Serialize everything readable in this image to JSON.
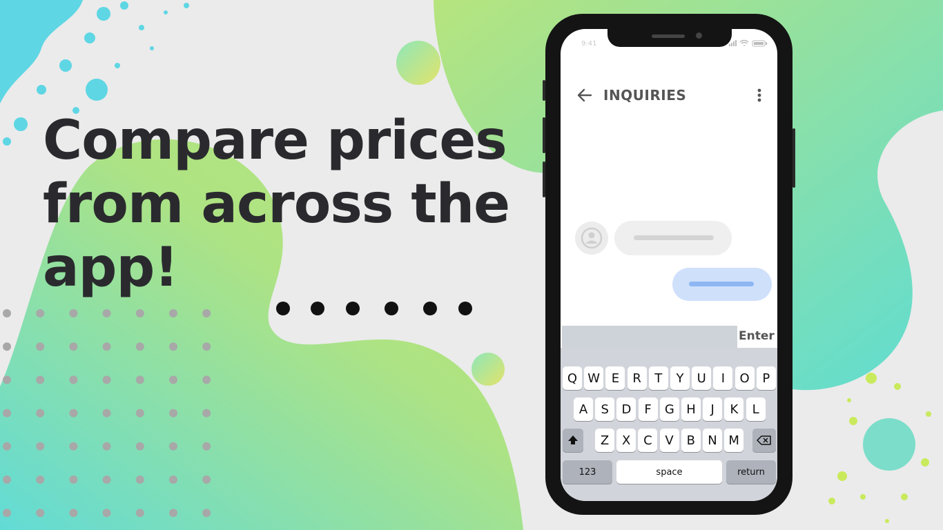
{
  "headline": {
    "line1": "Compare prices",
    "line2": "from across the",
    "line3": "app!"
  },
  "colors": {
    "background": "#ebebeb",
    "blob_green": "#aee383",
    "blob_teal": "#6fdccf",
    "headline": "#2a2a2e",
    "bubble_incoming": "#efefef",
    "bubble_outgoing": "#cfe0fb"
  },
  "phone": {
    "status_time": "9:41",
    "header": {
      "back_icon": "arrow-left-icon",
      "title": "INQUIRIES",
      "menu_icon": "more-vertical-icon"
    },
    "composer": {
      "value": "",
      "enter_label": "Enter"
    },
    "keyboard": {
      "row1": [
        "Q",
        "W",
        "E",
        "R",
        "T",
        "Y",
        "U",
        "I",
        "O",
        "P"
      ],
      "row2": [
        "A",
        "S",
        "D",
        "F",
        "G",
        "H",
        "J",
        "K",
        "L"
      ],
      "row3": [
        "Z",
        "X",
        "C",
        "V",
        "B",
        "N",
        "M"
      ],
      "shift_icon": "shift-arrow-icon",
      "backspace_icon": "backspace-icon",
      "numbers_label": "123",
      "space_label": "space",
      "return_label": "return",
      "emoji_icon": "emoji-icon",
      "mic_icon": "microphone-icon"
    }
  }
}
